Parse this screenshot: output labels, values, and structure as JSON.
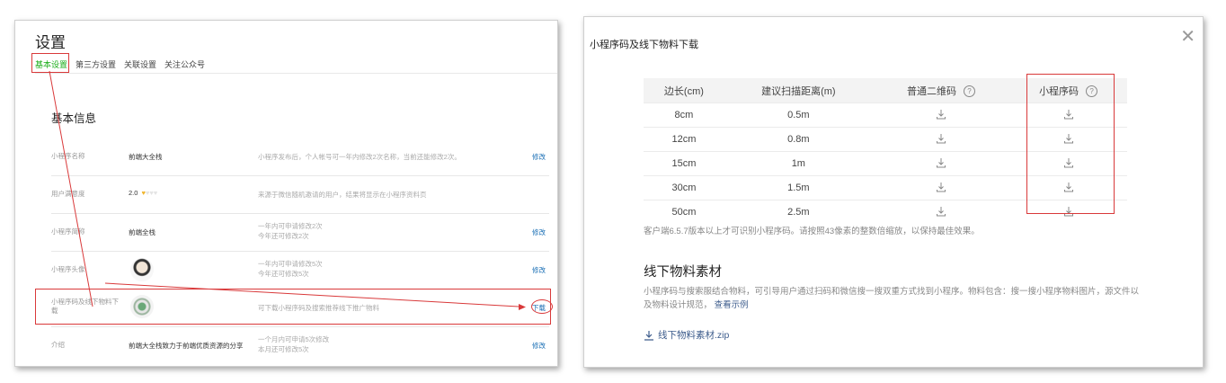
{
  "left": {
    "title": "设置",
    "tabs": [
      "基本设置",
      "第三方设置",
      "关联设置",
      "关注公众号"
    ],
    "section_title": "基本信息",
    "rows": [
      {
        "label": "小程序名称",
        "value": "前端大全栈",
        "desc": [
          "小程序发布后，个人帐号可一年内修改2次名称，当前还能修改2次。"
        ],
        "action": "修改"
      },
      {
        "label": "用户满意度",
        "value": "2.0",
        "desc": [
          "来源于微信随机邀请的用户，结果将显示在小程序资料页"
        ],
        "action": ""
      },
      {
        "label": "小程序简称",
        "value": "前端全栈",
        "desc": [
          "一年内可申请修改2次",
          "今年还可修改2次"
        ],
        "action": "修改"
      },
      {
        "label": "小程序头像",
        "value": "",
        "desc": [
          "一年内可申请修改5次",
          "今年还可修改5次"
        ],
        "action": "修改"
      },
      {
        "label": "小程序码及线下物料下载",
        "value": "",
        "desc": [
          "可下载小程序码及搜索推荐线下推广物料"
        ],
        "action": "下载"
      },
      {
        "label": "介绍",
        "value": "前端大全栈致力于前端优质资源的分享",
        "desc": [
          "一个月内可申请5次修改",
          "本月还可修改5次"
        ],
        "action": "修改"
      }
    ]
  },
  "right": {
    "title": "小程序码及线下物料下载",
    "headers": [
      "边长(cm)",
      "建议扫描距离(m)",
      "普通二维码",
      "小程序码"
    ],
    "rows": [
      [
        "8cm",
        "0.5m"
      ],
      [
        "12cm",
        "0.8m"
      ],
      [
        "15cm",
        "1m"
      ],
      [
        "30cm",
        "1.5m"
      ],
      [
        "50cm",
        "2.5m"
      ]
    ],
    "note": "客户端6.5.7版本以上才可识别小程序码。请按照43像素的整数倍缩放，以保持最佳效果。",
    "material_title": "线下物料素材",
    "material_desc": "小程序码与搜索服结合物料，可引导用户通过扫码和微信搜一搜双重方式找到小程序。物料包含：搜一搜小程序物料图片，源文件以及物料设计规范，",
    "material_link": "查看示例",
    "zip_label": "线下物料素材.zip"
  },
  "colors": {
    "highlight": "#d9393a",
    "green": "#1aad19",
    "link": "#1a6fb5",
    "heart": "#f0b52c"
  },
  "icons": [
    "download-icon",
    "help-icon",
    "close-icon",
    "heart-icon"
  ],
  "satisfaction_hearts": {
    "filled": 1,
    "total": 4
  }
}
